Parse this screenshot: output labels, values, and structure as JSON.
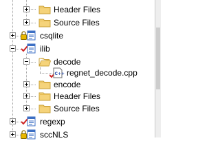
{
  "tree": {
    "rows": [
      {
        "label": "Header Files",
        "kind": "folder",
        "expander": "plus",
        "icon": "folder-closed-icon"
      },
      {
        "label": "Source Files",
        "kind": "folder",
        "expander": "plus",
        "icon": "folder-closed-icon"
      },
      {
        "label": "csqlite",
        "kind": "project",
        "expander": "plus",
        "icon": "project-icon"
      },
      {
        "label": "ilib",
        "kind": "project",
        "expander": "minus",
        "icon": "project-checked-out-icon"
      },
      {
        "label": "decode",
        "kind": "folder",
        "expander": "minus",
        "icon": "folder-open-icon"
      },
      {
        "label": "regnet_decode.cpp",
        "kind": "file",
        "expander": null,
        "icon": "cpp-file-checked-out-icon"
      },
      {
        "label": "encode",
        "kind": "folder",
        "expander": "plus",
        "icon": "folder-closed-icon"
      },
      {
        "label": "Header Files",
        "kind": "folder",
        "expander": "plus",
        "icon": "folder-closed-icon"
      },
      {
        "label": "Source Files",
        "kind": "folder",
        "expander": "plus",
        "icon": "folder-closed-icon"
      },
      {
        "label": "regexp",
        "kind": "project",
        "expander": "plus",
        "icon": "project-checked-out-icon"
      },
      {
        "label": "sccNLS",
        "kind": "project",
        "expander": "plus",
        "icon": "project-icon"
      }
    ]
  },
  "colors": {
    "folder": "#f5d37a",
    "folder_edge": "#c9a13a",
    "project_blue": "#3c6fc4",
    "lock": "#d9a400",
    "check_red": "#cc2222"
  }
}
